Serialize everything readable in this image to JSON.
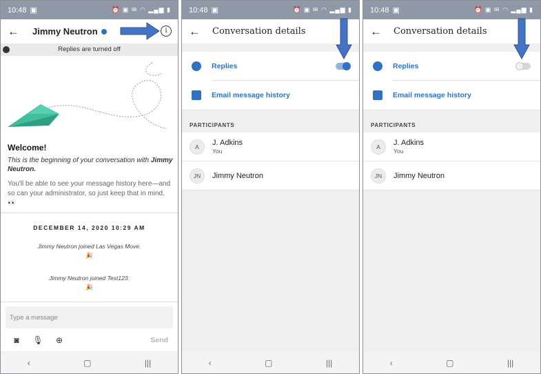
{
  "status": {
    "time": "10:48",
    "icons": "⏰ ▣ ✉ ◠ ▂▄▆ ▮"
  },
  "screen1": {
    "contact_name": "Jimmy Neutron",
    "banner": "Replies are turned off",
    "welcome_title": "Welcome!",
    "welcome_text": "This is the beginning of your conversation with",
    "welcome_name": "Jimmy Neutron.",
    "welcome_note": "You'll be able to see your message history here—and so can your administrator, so just keep that in mind. 👀",
    "date": "DECEMBER 14, 2020 10:29 AM",
    "events": [
      {
        "text": "Jimmy Neutron joined Las Vegas Move.",
        "emoji": "🎉"
      },
      {
        "text": "Jimmy Neutron joined Test123.",
        "emoji": "🎉"
      }
    ],
    "message_placeholder": "Type a message",
    "send_label": "Send"
  },
  "details": {
    "title": "Conversation details",
    "replies_label": "Replies",
    "email_label": "Email message history",
    "participants_header": "PARTICIPANTS",
    "participants": [
      {
        "initials": "A",
        "name": "J. Adkins",
        "sub": "You"
      },
      {
        "initials": "JN",
        "name": "Jimmy Neutron",
        "sub": ""
      }
    ]
  },
  "toggles": {
    "screen2_replies_on": true,
    "screen3_replies_on": false
  },
  "colors": {
    "accent": "#2f72c4",
    "annotation_arrow": "#4472c4",
    "plane": "#3fbfa0"
  },
  "icons": {
    "back": "arrow-left-icon",
    "info": "info-icon",
    "verified": "verified-badge-icon",
    "camera": "camera-icon",
    "mic": "microphone-icon",
    "globe": "globe-icon",
    "replies": "chat-bubble-icon",
    "email": "email-icon"
  }
}
